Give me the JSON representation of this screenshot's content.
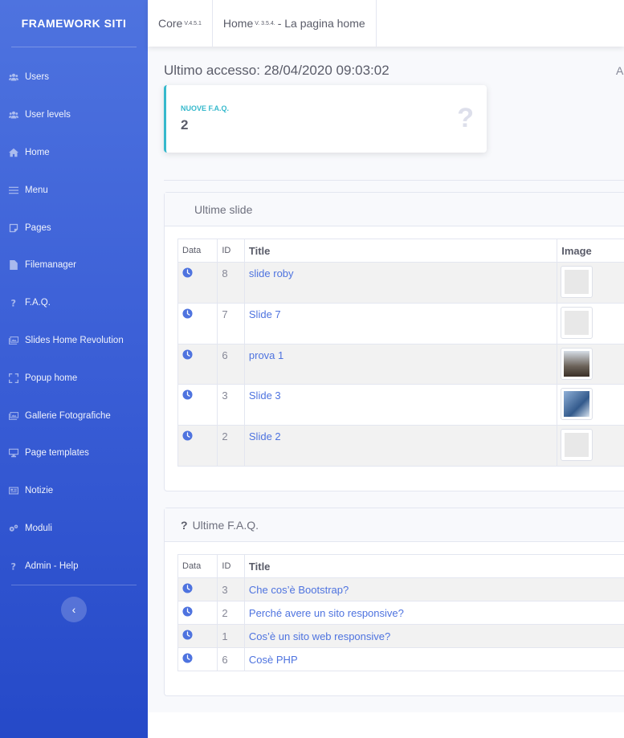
{
  "sidebar": {
    "brand": "FRAMEWORK SITI",
    "items": [
      {
        "label": "Users",
        "icon": "users-icon"
      },
      {
        "label": "User levels",
        "icon": "users-icon"
      },
      {
        "label": "Home",
        "icon": "home-icon"
      },
      {
        "label": "Menu",
        "icon": "bars-icon"
      },
      {
        "label": "Pages",
        "icon": "page-icon"
      },
      {
        "label": "Filemanager",
        "icon": "file-icon"
      },
      {
        "label": "F.A.Q.",
        "icon": "question-icon"
      },
      {
        "label": "Slides Home Revolution",
        "icon": "images-icon"
      },
      {
        "label": "Popup home",
        "icon": "expand-icon"
      },
      {
        "label": "Gallerie Fotografiche",
        "icon": "images-icon"
      },
      {
        "label": "Page templates",
        "icon": "desktop-icon"
      },
      {
        "label": "Notizie",
        "icon": "newspaper-icon"
      },
      {
        "label": "Moduli",
        "icon": "cogs-icon"
      },
      {
        "label": "Admin - Help",
        "icon": "question-icon"
      }
    ],
    "toggle_icon": "chevron-left-icon",
    "toggle_glyph": "‹"
  },
  "topbar": {
    "core_label": "Core",
    "core_version": "V.4.5.1",
    "home_label": "Home",
    "home_version": "V. 3.5.4.",
    "home_rest": "- La pagina home"
  },
  "main": {
    "last_access": "Ultimo accesso: 28/04/2020 09:03:02",
    "right_cut": "A",
    "faq_card": {
      "label": "NUOVE F.A.Q.",
      "value": "2",
      "icon_glyph": "?"
    }
  },
  "slides_panel": {
    "title": "Ultime slide",
    "headers": {
      "data": "Data",
      "id": "ID",
      "title": "Title",
      "image": "Image"
    },
    "rows": [
      {
        "id": "8",
        "title": "slide roby",
        "image": "placeholder"
      },
      {
        "id": "7",
        "title": "Slide 7",
        "image": "placeholder"
      },
      {
        "id": "6",
        "title": "prova 1",
        "image": "photo"
      },
      {
        "id": "3",
        "title": "Slide 3",
        "image": "photo"
      },
      {
        "id": "2",
        "title": "Slide 2",
        "image": "placeholder"
      }
    ]
  },
  "faq_panel": {
    "title": "Ultime F.A.Q.",
    "title_icon": "?",
    "headers": {
      "data": "Data",
      "id": "ID",
      "title": "Title"
    },
    "rows": [
      {
        "id": "3",
        "title": "Che cos’è Bootstrap?"
      },
      {
        "id": "2",
        "title": "Perché avere un sito responsive?"
      },
      {
        "id": "1",
        "title": "Cos’è un sito web responsive?"
      },
      {
        "id": "6",
        "title": "Cosè PHP"
      }
    ]
  },
  "colors": {
    "primary": "#4e73df",
    "info": "#36b9cc",
    "sidebar_dark": "#2549c8"
  }
}
